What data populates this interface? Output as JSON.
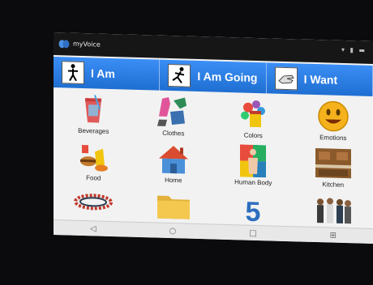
{
  "app": {
    "title": "myVoice"
  },
  "tabs": [
    {
      "label": "I Am",
      "icon": "standing-person-icon"
    },
    {
      "label": "I Am Going",
      "icon": "running-person-icon"
    },
    {
      "label": "I Want",
      "icon": "hand-icon"
    }
  ],
  "categories": [
    {
      "label": "Beverages",
      "icon": "beverage-icon"
    },
    {
      "label": "Clothes",
      "icon": "clothes-icon"
    },
    {
      "label": "Colors",
      "icon": "colors-icon"
    },
    {
      "label": "Emotions",
      "icon": "emotion-face-icon"
    },
    {
      "label": "Food",
      "icon": "food-icon"
    },
    {
      "label": "Home",
      "icon": "house-icon"
    },
    {
      "label": "Human Body",
      "icon": "human-body-icon"
    },
    {
      "label": "Kitchen",
      "icon": "kitchen-icon"
    },
    {
      "label": "",
      "icon": "bracelet-icon"
    },
    {
      "label": "",
      "icon": "folder-icon"
    },
    {
      "label": "",
      "icon": "number-icon"
    },
    {
      "label": "",
      "icon": "people-icon"
    }
  ],
  "navbar": {
    "back": "◁",
    "home": "○",
    "recent": "□",
    "extra": "⊞"
  },
  "colors": {
    "tab_blue": "#2b7ee6",
    "status_bg": "#161616"
  }
}
